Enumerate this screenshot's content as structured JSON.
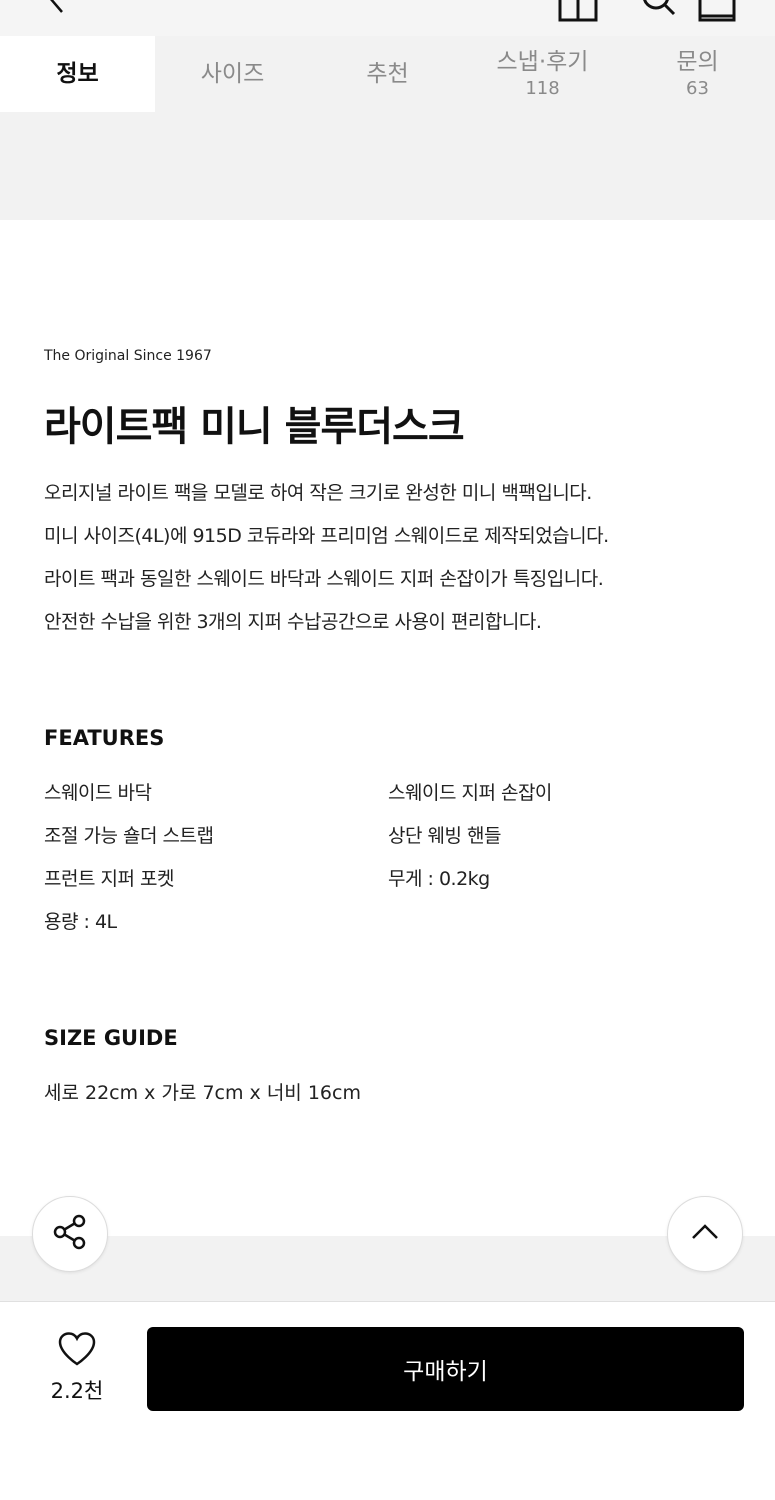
{
  "tabs": [
    {
      "label": "정보",
      "count": ""
    },
    {
      "label": "사이즈",
      "count": ""
    },
    {
      "label": "추천",
      "count": ""
    },
    {
      "label": "스냅·후기",
      "count": "118"
    },
    {
      "label": "문의",
      "count": "63"
    }
  ],
  "product": {
    "brand_line": "The Original Since 1967",
    "title": "라이트팩 미니 블루더스크",
    "description": [
      "오리지널 라이트 팩을 모델로 하여 작은 크기로 완성한 미니 백팩입니다.",
      "미니 사이즈(4L)에 915D 코듀라와 프리미엄 스웨이드로 제작되었습니다.",
      "라이트 팩과 동일한 스웨이드 바닥과 스웨이드 지퍼 손잡이가 특징입니다.",
      "안전한 수납을 위한 3개의 지퍼 수납공간으로 사용이 편리합니다."
    ]
  },
  "features": {
    "title": "FEATURES",
    "items": [
      "스웨이드 바닥",
      "스웨이드 지퍼 손잡이",
      "조절 가능 숄더 스트랩",
      "상단 웨빙 핸들",
      "프런트 지퍼 포켓",
      "무게 : 0.2kg",
      "용량 : 4L"
    ]
  },
  "size_guide": {
    "title": "SIZE GUIDE",
    "text": "세로 22cm x 가로 7cm x 너비 16cm"
  },
  "action_bar": {
    "like_count": "2.2천",
    "buy_label": "구매하기"
  },
  "colors": {
    "accent": "#000000",
    "tab_inactive": "#8a8a8a",
    "band": "#f2f2f2"
  }
}
